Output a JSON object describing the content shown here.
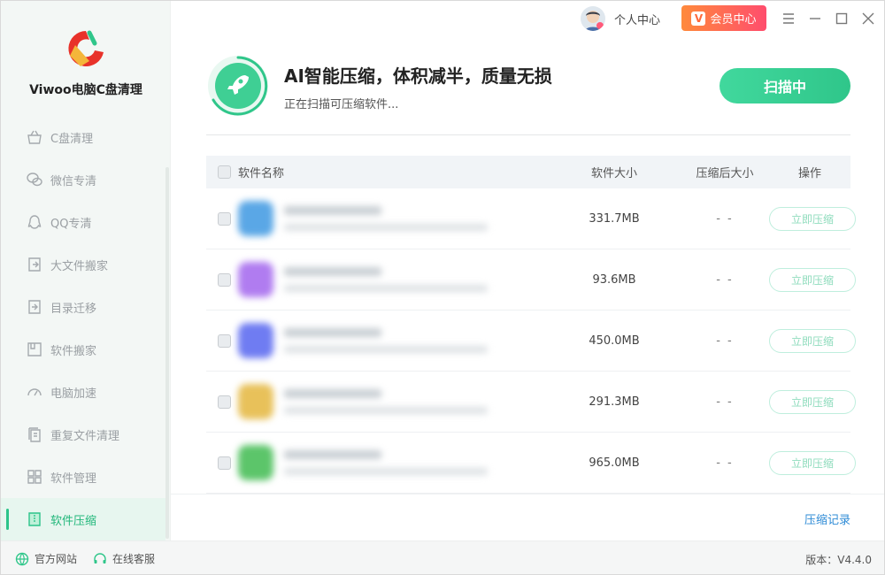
{
  "app": {
    "name": "Viwoo电脑C盘清理"
  },
  "topbar": {
    "user_label": "个人中心",
    "vip_label": "会员中心",
    "vip_badge": "V"
  },
  "sidebar": {
    "items": [
      {
        "label": "C盘清理",
        "icon": "basket-icon"
      },
      {
        "label": "微信专清",
        "icon": "wechat-icon"
      },
      {
        "label": "QQ专清",
        "icon": "qq-icon"
      },
      {
        "label": "大文件搬家",
        "icon": "move-file-icon"
      },
      {
        "label": "目录迁移",
        "icon": "folder-migrate-icon"
      },
      {
        "label": "软件搬家",
        "icon": "software-move-icon"
      },
      {
        "label": "电脑加速",
        "icon": "speedometer-icon"
      },
      {
        "label": "重复文件清理",
        "icon": "duplicate-file-icon"
      },
      {
        "label": "软件管理",
        "icon": "grid-icon"
      },
      {
        "label": "软件压缩",
        "icon": "compress-file-icon",
        "active": true
      }
    ]
  },
  "header": {
    "title": "AI智能压缩，体积减半，质量无损",
    "subtitle": "正在扫描可压缩软件...",
    "scan_button": "扫描中"
  },
  "table": {
    "headers": {
      "name": "软件名称",
      "size": "软件大小",
      "after": "压缩后大小",
      "op": "操作"
    },
    "rows": [
      {
        "size": "331.7MB",
        "after": "- -",
        "action": "立即压缩",
        "icon_color": "#5aa7e6"
      },
      {
        "size": "93.6MB",
        "after": "- -",
        "action": "立即压缩",
        "icon_color": "#b07cf0"
      },
      {
        "size": "450.0MB",
        "after": "- -",
        "action": "立即压缩",
        "icon_color": "#6f7cf2"
      },
      {
        "size": "291.3MB",
        "after": "- -",
        "action": "立即压缩",
        "icon_color": "#e8c15a"
      },
      {
        "size": "965.0MB",
        "after": "- -",
        "action": "立即压缩",
        "icon_color": "#5cc56a"
      }
    ]
  },
  "footer": {
    "records": "压缩记录",
    "website": "官方网站",
    "support": "在线客服",
    "version": "版本：V4.4.0"
  },
  "colors": {
    "accent": "#2fc68a",
    "vip": "#ff5a55",
    "link": "#2e8bd6"
  }
}
